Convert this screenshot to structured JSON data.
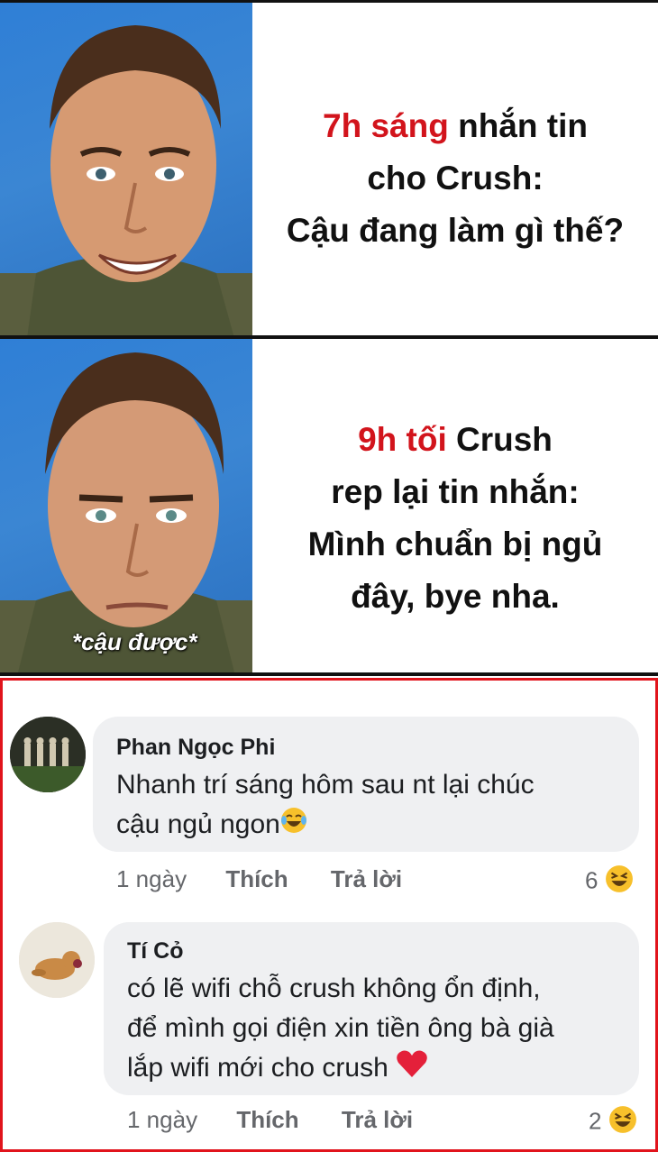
{
  "meme": {
    "panel1": {
      "red": "7h sáng",
      "rest1": " nhắn tin",
      "line2": "cho Crush:",
      "line3": "Cậu đang làm gì thế?"
    },
    "panel2": {
      "red": "9h tối",
      "rest1": " Crush",
      "line2": "rep lại tin nhắn:",
      "line3": "Mình chuẩn bị ngủ",
      "line4": "đây, bye nha.",
      "overlay": "*cậu được*"
    }
  },
  "comments": [
    {
      "name": "Phan Ngọc Phi",
      "text_line1": "Nhanh trí sáng hôm sau nt lại chúc",
      "text_line2": "cậu ngủ ngon",
      "emoji": "crying-laughing-icon",
      "time": "1 ngày",
      "like": "Thích",
      "reply": "Trả lời",
      "reactions": "6",
      "reaction_icon": "laughing-icon"
    },
    {
      "name": "Tí Cỏ",
      "text_line1": "có lẽ wifi chỗ crush không ổn định,",
      "text_line2": "để mình gọi điện xin tiền ông bà già",
      "text_line3": "lắp wifi mới cho crush",
      "emoji": "heart-icon",
      "time": "1 ngày",
      "like": "Thích",
      "reply": "Trả lời",
      "reactions": "2",
      "reaction_icon": "laughing-icon"
    }
  ],
  "colors": {
    "accent_red": "#d2141c",
    "border_red": "#e1141c",
    "bubble": "#eff0f2",
    "meta": "#65676b"
  }
}
